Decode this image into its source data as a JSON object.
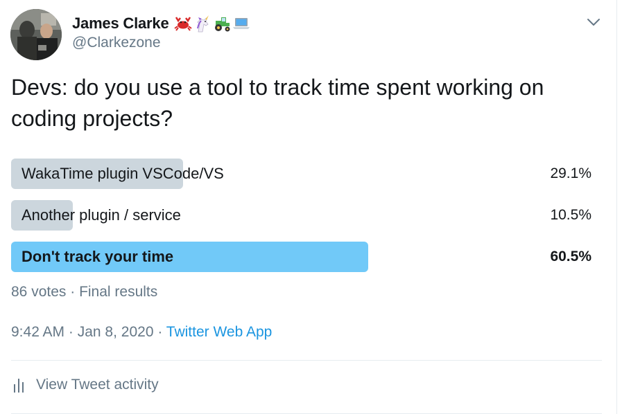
{
  "user": {
    "display_name": "James Clarke",
    "handle": "@Clarkezone",
    "emojis": [
      "crab-icon",
      "unicorn-icon",
      "tractor-icon",
      "laptop-icon"
    ]
  },
  "tweet": {
    "text": "Devs: do you use a tool to track time spent working on coding projects?"
  },
  "poll": {
    "options": [
      {
        "label": "WakaTime plugin VSCode/VS",
        "percent": "29.1%",
        "fraction": 0.291,
        "winner": false
      },
      {
        "label": "Another plugin / service",
        "percent": "10.5%",
        "fraction": 0.105,
        "winner": false
      },
      {
        "label": "Don't track your time",
        "percent": "60.5%",
        "fraction": 0.605,
        "winner": true
      }
    ],
    "votes": "86 votes",
    "separator": " · ",
    "status": "Final results"
  },
  "meta": {
    "time": "9:42 AM",
    "date": "Jan 8, 2020",
    "separator": " · ",
    "source": "Twitter Web App"
  },
  "activity": {
    "label": "View Tweet activity"
  },
  "colors": {
    "poll_bar": "#ccd6dd",
    "poll_bar_winner": "#71c9f8",
    "link": "#1b95e0",
    "secondary_text": "#657786"
  }
}
